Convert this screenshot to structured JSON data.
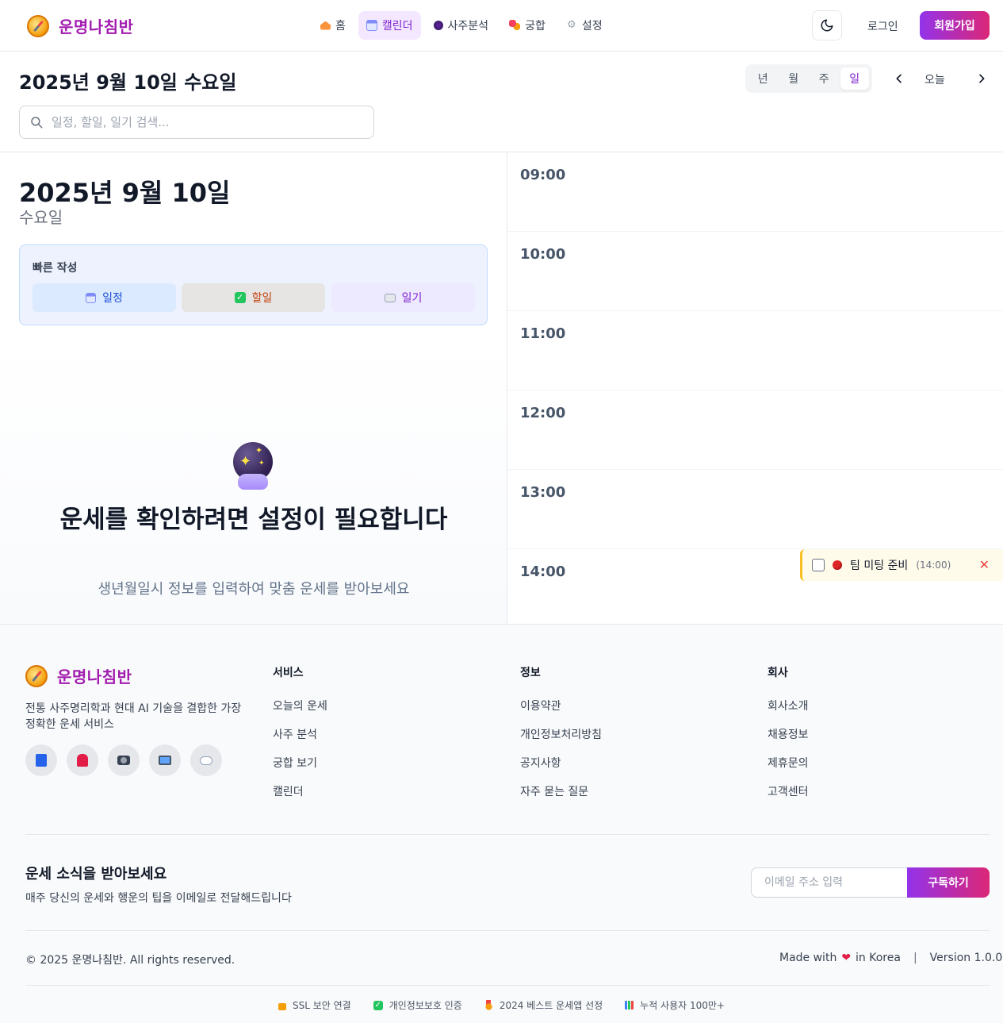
{
  "header": {
    "logo_text": "운명나침반",
    "nav": [
      {
        "label": "홈",
        "icon": "house-icon"
      },
      {
        "label": "캘린더",
        "icon": "calendar-icon",
        "active": true
      },
      {
        "label": "사주분석",
        "icon": "crystal-ball-icon"
      },
      {
        "label": "궁합",
        "icon": "flowers-icon"
      },
      {
        "label": "설정",
        "icon": "gear-icon"
      }
    ],
    "login_label": "로그인",
    "signup_label": "회원가입"
  },
  "toolbar": {
    "date_title": "2025년 9월 10일 수요일",
    "views": [
      "년",
      "월",
      "주",
      "일"
    ],
    "active_view": "일",
    "today_label": "오늘",
    "search_placeholder": "일정, 할일, 일기 검색..."
  },
  "day_panel": {
    "date": "2025년 9월 10일",
    "weekday": "수요일",
    "quick_title": "빠른 작성",
    "quick_buttons": [
      "일정",
      "할일",
      "일기"
    ],
    "notice_title": "운세를 확인하려면 설정이 필요합니다",
    "notice_sub": "생년월일시 정보를 입력하여 맞춤 운세를 받아보세요"
  },
  "timeline": {
    "hours": [
      "09:00",
      "10:00",
      "11:00",
      "12:00",
      "13:00",
      "14:00"
    ],
    "event": {
      "title": "팀 미팅 준비",
      "time": "(14:00)",
      "color": "#dc2626"
    }
  },
  "footer": {
    "logo_text": "운명나침반",
    "description": "전통 사주명리학과 현대 AI 기술을 결합한 가장 정확한 운세 서비스",
    "socials": [
      "book-icon",
      "chair-icon",
      "camera-icon",
      "tv-icon",
      "chat-icon"
    ],
    "columns": [
      {
        "title": "서비스",
        "links": [
          "오늘의 운세",
          "사주 분석",
          "궁합 보기",
          "캘린더"
        ]
      },
      {
        "title": "정보",
        "links": [
          "이용약관",
          "개인정보처리방침",
          "공지사항",
          "자주 묻는 질문"
        ]
      },
      {
        "title": "회사",
        "links": [
          "회사소개",
          "채용정보",
          "제휴문의",
          "고객센터"
        ]
      }
    ],
    "newsletter": {
      "title": "운세 소식을 받아보세요",
      "subtitle": "매주 당신의 운세와 행운의 팁을 이메일로 전달해드립니다",
      "placeholder": "이메일 주소 입력",
      "button": "구독하기"
    },
    "copyright": "© 2025 운명나침반. All rights reserved.",
    "made_with_prefix": "Made with",
    "made_with_suffix": "in Korea",
    "version": "Version 1.0.0",
    "badges": [
      "SSL 보안 연결",
      "개인정보보호 인증",
      "2024 베스트 운세앱 선정",
      "누적 사용자 100만+"
    ]
  }
}
